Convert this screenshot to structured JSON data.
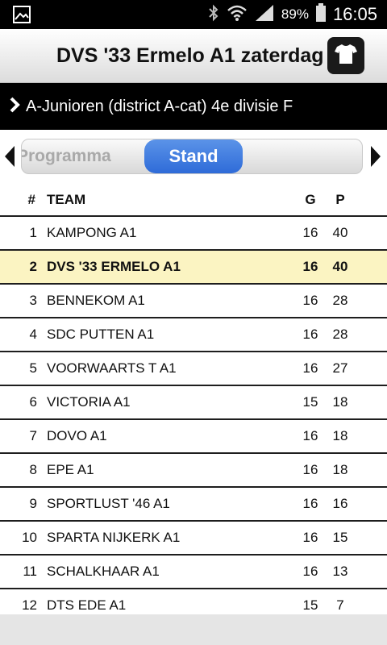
{
  "status_bar": {
    "battery_pct": "89%",
    "time": "16:05",
    "icons": [
      "gallery-icon",
      "bluetooth-icon",
      "wifi-icon",
      "signal-icon",
      "battery-icon"
    ]
  },
  "header": {
    "title": "DVS '33 Ermelo A1 zaterdag",
    "shirt_icon": "shirt-icon"
  },
  "division": {
    "label": "A-Junioren (district A-cat) 4e divisie F"
  },
  "tabs": {
    "items": [
      "Programma",
      "Stand"
    ],
    "selected": "Stand",
    "accent": "#3a78e0"
  },
  "table": {
    "columns": [
      "#",
      "TEAM",
      "G",
      "P"
    ],
    "rows": [
      {
        "rank": "1",
        "team": "KAMPONG A1",
        "g": "16",
        "p": "40"
      },
      {
        "rank": "2",
        "team": "DVS '33 ERMELO A1",
        "g": "16",
        "p": "40",
        "highlight": true
      },
      {
        "rank": "3",
        "team": "BENNEKOM A1",
        "g": "16",
        "p": "28"
      },
      {
        "rank": "4",
        "team": "SDC PUTTEN A1",
        "g": "16",
        "p": "28"
      },
      {
        "rank": "5",
        "team": "VOORWAARTS T A1",
        "g": "16",
        "p": "27"
      },
      {
        "rank": "6",
        "team": "VICTORIA A1",
        "g": "15",
        "p": "18"
      },
      {
        "rank": "7",
        "team": "DOVO A1",
        "g": "16",
        "p": "18"
      },
      {
        "rank": "8",
        "team": "EPE A1",
        "g": "16",
        "p": "18"
      },
      {
        "rank": "9",
        "team": "SPORTLUST '46 A1",
        "g": "16",
        "p": "16"
      },
      {
        "rank": "10",
        "team": "SPARTA NIJKERK A1",
        "g": "16",
        "p": "15"
      },
      {
        "rank": "11",
        "team": "SCHALKHAAR A1",
        "g": "16",
        "p": "13"
      },
      {
        "rank": "12",
        "team": "DTS EDE A1",
        "g": "15",
        "p": "7"
      }
    ],
    "highlight_color": "#fbf4c2"
  }
}
